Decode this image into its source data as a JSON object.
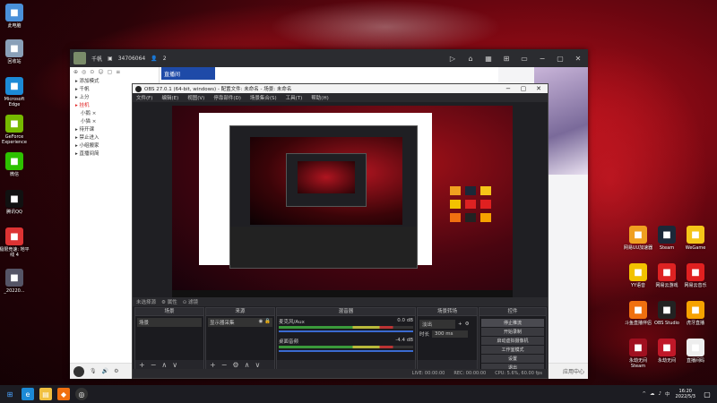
{
  "desktop_icons_left": [
    {
      "label": "此电脑",
      "icon": "computer-icon",
      "color": "#4a90d9"
    },
    {
      "label": "回收站",
      "icon": "recycle-bin-icon",
      "color": "#8aa0b8"
    },
    {
      "label": "Microsoft Edge",
      "icon": "edge-icon",
      "color": "#1c8ad6"
    },
    {
      "label": "GeForce Experience",
      "icon": "nvidia-icon",
      "color": "#76b900"
    },
    {
      "label": "微信",
      "icon": "wechat-icon",
      "color": "#2dc100"
    },
    {
      "label": "腾讯QQ",
      "icon": "qq-icon",
      "color": "#111111"
    },
    {
      "label": "极限竞速: 地平线 4",
      "icon": "forza-icon",
      "color": "#d33"
    },
    {
      "label": "_20220...",
      "icon": "file-icon",
      "color": "#556"
    }
  ],
  "desktop_icons_right": [
    {
      "label": "网易UU加速器",
      "icon": "uu-icon",
      "color": "#f0a020"
    },
    {
      "label": "Steam",
      "icon": "steam-icon",
      "color": "#1b2838"
    },
    {
      "label": "WeGame",
      "icon": "wegame-icon",
      "color": "#f5c518"
    },
    {
      "label": "YY语音",
      "icon": "yy-icon",
      "color": "#f2c200"
    },
    {
      "label": "网易云游戏",
      "icon": "netease-cloud-icon",
      "color": "#d22"
    },
    {
      "label": "网易云音乐",
      "icon": "netease-music-icon",
      "color": "#e02020"
    },
    {
      "label": "斗鱼直播伴侣",
      "icon": "douyu-icon",
      "color": "#f07010"
    },
    {
      "label": "OBS Studio",
      "icon": "obs-icon",
      "color": "#222"
    },
    {
      "label": "虎牙直播",
      "icon": "huya-icon",
      "color": "#f6a200"
    },
    {
      "label": "永劫无间 Steam",
      "icon": "naraka-icon",
      "color": "#a01020"
    },
    {
      "label": "永劫无间",
      "icon": "naraka-icon",
      "color": "#c01828"
    },
    {
      "label": "直播间码",
      "icon": "document-icon",
      "color": "#eee"
    }
  ],
  "live_app": {
    "username": "千帆",
    "room_id": "34706064",
    "viewers": "2",
    "banner": "直播间",
    "sidebar_tools": [
      "⊕",
      "◎",
      "⊙",
      "☺",
      "▢",
      "≡"
    ],
    "sidebar_items": [
      {
        "label": "添加模式",
        "cls": ""
      },
      {
        "label": "千帆",
        "cls": ""
      },
      {
        "label": "上分",
        "cls": ""
      },
      {
        "label": "挂机",
        "cls": "red"
      },
      {
        "label": "小鹅 ×",
        "cls": "sub"
      },
      {
        "label": "小猫 ×",
        "cls": "sub"
      },
      {
        "label": "待开课",
        "cls": ""
      },
      {
        "label": "禁止进入",
        "cls": ""
      },
      {
        "label": "小组搬家",
        "cls": ""
      },
      {
        "label": "直播间简",
        "cls": ""
      }
    ],
    "bottom_right": "应用中心"
  },
  "obs": {
    "title": "OBS 27.0.1 (64-bit, windows) - 配置文件: 未命名 - 场景: 未命名",
    "menu": [
      "文件(F)",
      "编辑(E)",
      "视图(V)",
      "停靠部件(D)",
      "场景集合(S)",
      "工具(T)",
      "帮助(H)"
    ],
    "below_preview": [
      "未选择源",
      "⚙ 属性",
      "⊙ 滤镜"
    ],
    "docks": {
      "scenes": {
        "title": "场景",
        "items": [
          "场景"
        ]
      },
      "sources": {
        "title": "来源",
        "items": [
          "显示器采集"
        ]
      },
      "mixer": {
        "title": "混音器",
        "tracks": [
          {
            "name": "麦克风/Aux",
            "level": "0.0 dB"
          },
          {
            "name": "桌面音频",
            "level": "-4.4 dB"
          }
        ]
      },
      "transitions": {
        "title": "场景转场",
        "type": "淡出",
        "duration_label": "时长",
        "duration": "300 ms"
      },
      "controls": {
        "title": "控件",
        "buttons": [
          "停止推流",
          "开始录制",
          "启动虚拟摄像机",
          "工作室模式",
          "设置",
          "退出"
        ]
      }
    },
    "status": [
      "LIVE: 00:00:00",
      "REC: 00:00:00",
      "CPU: 5.6%, 60.00 fps"
    ]
  },
  "taskbar": {
    "time": "16:20",
    "date": "2022/5/3",
    "tray": [
      "^",
      "☁",
      "♪",
      "中"
    ]
  }
}
